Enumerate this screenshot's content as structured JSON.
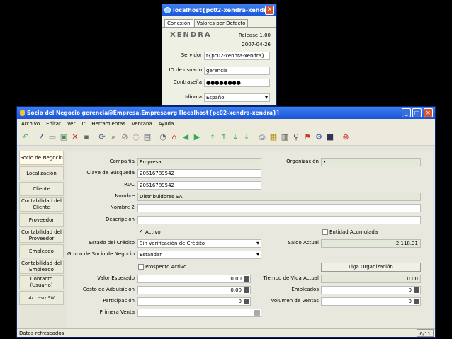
{
  "login": {
    "title": "localhost{pc02-xendra-xendra}",
    "tabs": [
      "Conexión",
      "Valores por Defecto"
    ],
    "logo": "XENDRA",
    "release": "Release 1.00",
    "date": "2007-04-26",
    "servidor_label": "Servidor",
    "servidor": "t{pc02-xendra-xendra}",
    "user_label": "ID de usuario",
    "user": "gerencia",
    "pass_label": "Contraseña",
    "pass": "●●●●●●●●",
    "idioma_label": "Idioma",
    "idioma": "Español"
  },
  "main": {
    "title": "Socio del Negocio  gerencia@Empresa.Empresaorg [localhost{pc02-xendra-xendra}]",
    "menu": [
      "Archivo",
      "Editar",
      "Ver",
      "Ir",
      "Herramientas",
      "Ventana",
      "Ayuda"
    ],
    "side": [
      "Socio de Negocio",
      "Localización",
      "Cliente",
      "Contabilidad del Cliente",
      "Proveedor",
      "Contabilidad del Proveedor",
      "Empleado",
      "Contabilidad del Empleado",
      "Contacto (Usuario)",
      "Acceso SN"
    ],
    "compania_l": "Compañía",
    "compania": "Empresa",
    "org_l": "Organización",
    "org": "•",
    "clave_l": "Clave de Búsqueda",
    "clave": "20516789542",
    "ruc_l": "RUC",
    "ruc": "20516789542",
    "nombre_l": "Nombre",
    "nombre": "Distribuidores SA",
    "nombre2_l": "Nombre 2",
    "desc_l": "Descripción",
    "activo": "Activo",
    "entidad": "Entidad Acumulada",
    "estado_l": "Estado del Crédito",
    "estado": "Sin Verificación de Crédito",
    "saldo_l": "Saldo Actual",
    "saldo": "-2,118.31",
    "grupo_l": "Grupo de Socio de Negocio",
    "grupo": "Estándar",
    "prospecto": "Prospecto Activo",
    "liga": "Liga Organización",
    "valor_l": "Valor Esperado",
    "valor": "0.00",
    "tiempo_l": "Tiempo de Vida Actual",
    "tiempo": "0.00",
    "costo_l": "Costo de Adquisición",
    "costo": "0.00",
    "empleados_l": "Empleados",
    "empleados": "0",
    "part_l": "Participación",
    "part": "0",
    "vol_l": "Volumen de Ventas",
    "vol": "0",
    "primera_l": "Primera Venta",
    "status": "Datos refrescados",
    "page": "6/11"
  }
}
